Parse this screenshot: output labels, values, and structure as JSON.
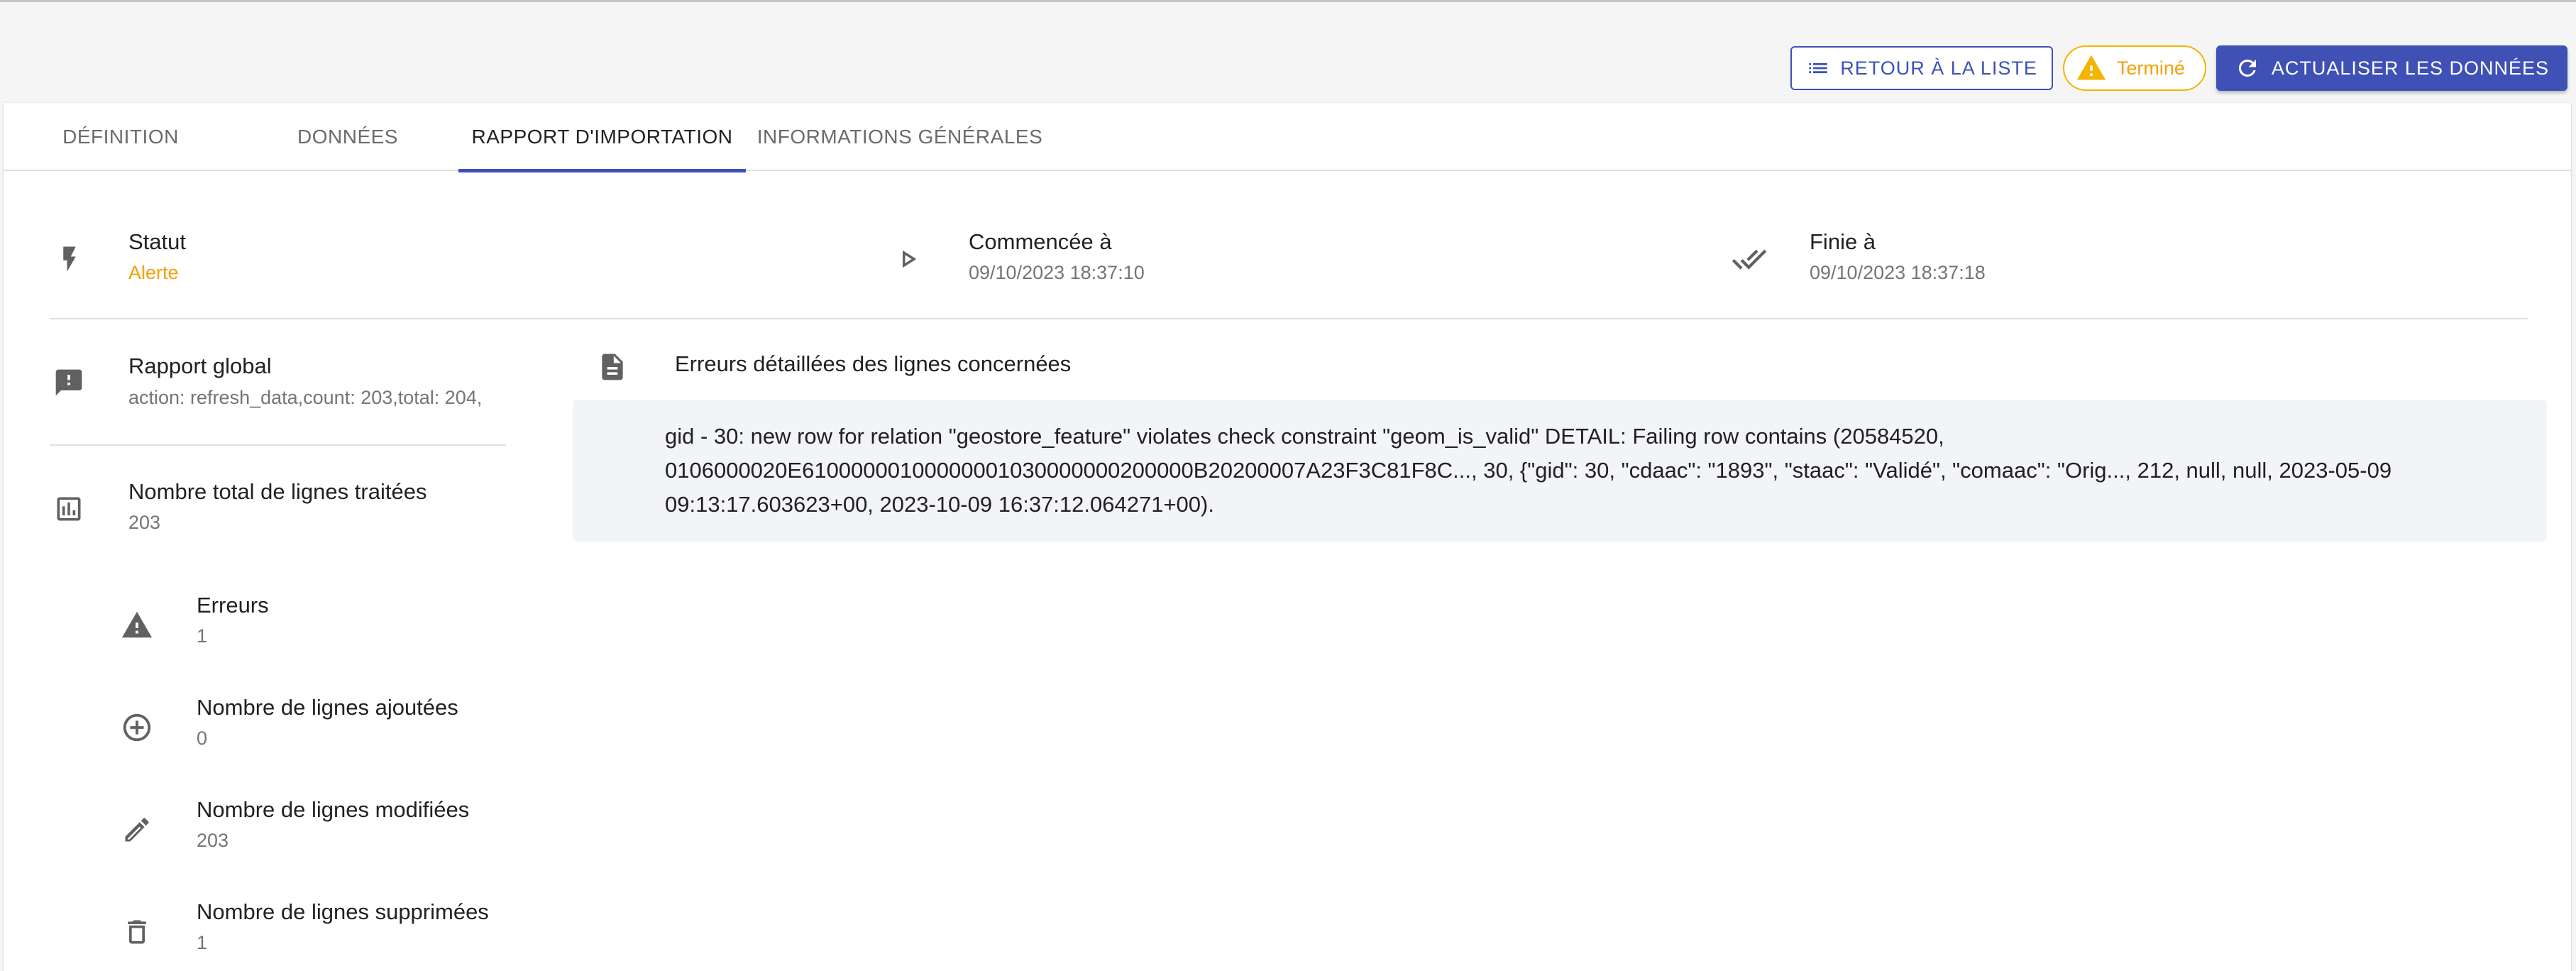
{
  "header": {
    "back_button_label": "Retour à la liste",
    "status_chip_label": "Terminé",
    "refresh_button_label": "Actualiser les données"
  },
  "tabs": [
    {
      "label": "Définition",
      "active": false
    },
    {
      "label": "Données",
      "active": false
    },
    {
      "label": "Rapport d'importation",
      "active": true
    },
    {
      "label": "Informations générales",
      "active": false
    }
  ],
  "summary": {
    "status": {
      "label": "Statut",
      "value": "Alerte"
    },
    "started": {
      "label": "Commencée à",
      "value": "09/10/2023 18:37:10"
    },
    "finished": {
      "label": "Finie à",
      "value": "09/10/2023 18:37:18"
    }
  },
  "report": {
    "global": {
      "label": "Rapport global",
      "value": "action: refresh_data,count: 203,total: 204,"
    },
    "total_lines": {
      "label": "Nombre total de lignes traitées",
      "value": "203"
    },
    "errors": {
      "label": "Erreurs",
      "value": "1"
    },
    "added": {
      "label": "Nombre de lignes ajoutées",
      "value": "0"
    },
    "modified": {
      "label": "Nombre de lignes modifiées",
      "value": "203"
    },
    "deleted": {
      "label": "Nombre de lignes supprimées",
      "value": "1"
    }
  },
  "errors_panel": {
    "title": "Erreurs détaillées des lignes concernées",
    "message": "gid - 30: new row for relation \"geostore_feature\" violates check constraint \"geom_is_valid\" DETAIL: Failing row contains (20584520, 0106000020E61000000100000001030000000200000B20200007A23F3C81F8C..., 30, {\"gid\": 30, \"cdaac\": \"1893\", \"staac\": \"Validé\", \"comaac\": \"Orig..., 212, null, null, 2023-05-09 09:13:17.603623+00, 2023-10-09 16:37:12.064271+00)."
  },
  "colors": {
    "primary": "#3f51b5",
    "warning": "#f4a000",
    "icon": "#616161"
  },
  "icons": [
    "list-icon",
    "warning-icon",
    "refresh-icon",
    "bolt-icon",
    "play-icon",
    "done-all-icon",
    "feedback-icon",
    "bar-chart-icon",
    "document-icon",
    "add-circle-icon",
    "pencil-icon",
    "trash-icon"
  ]
}
